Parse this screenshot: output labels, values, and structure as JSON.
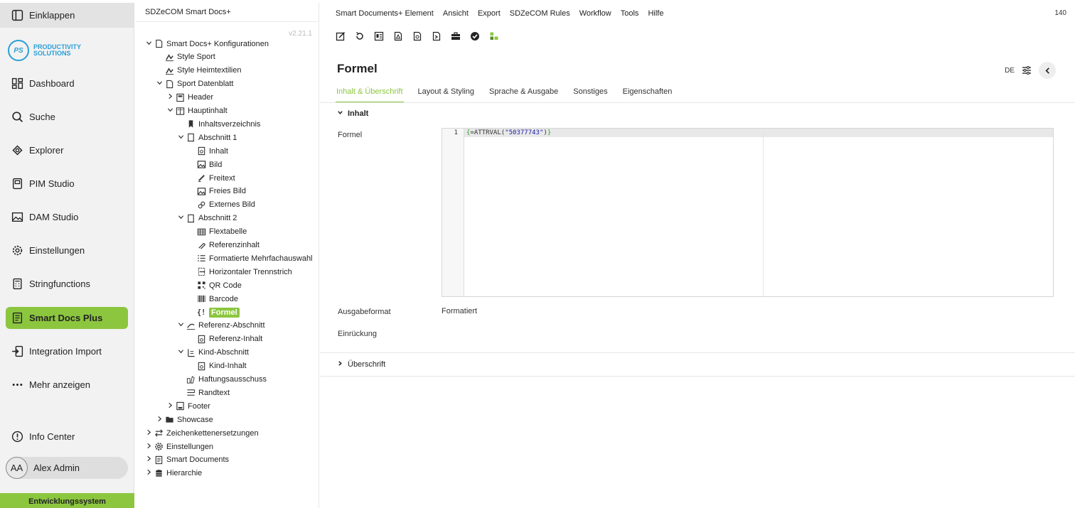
{
  "nav": {
    "collapse_label": "Einklappen",
    "logo_short": "PS",
    "logo_line1": "PRODUCTIVITY",
    "logo_line2": "SOLUTIONS",
    "items": [
      {
        "label": "Dashboard",
        "icon": "dashboard-icon"
      },
      {
        "label": "Suche",
        "icon": "search-icon"
      },
      {
        "label": "Explorer",
        "icon": "explorer-icon"
      },
      {
        "label": "PIM Studio",
        "icon": "pim-icon"
      },
      {
        "label": "DAM Studio",
        "icon": "image-icon"
      },
      {
        "label": "Einstellungen",
        "icon": "gear-icon"
      },
      {
        "label": "Stringfunctions",
        "icon": "calculator-icon"
      },
      {
        "label": "Smart Docs Plus",
        "icon": "document-icon"
      },
      {
        "label": "Integration Import",
        "icon": "import-icon"
      },
      {
        "label": "Mehr anzeigen",
        "icon": "more-icon"
      }
    ],
    "info_center": "Info Center",
    "user_initials": "AA",
    "user_name": "Alex Admin",
    "environment": "Entwicklungssystem",
    "accent_color": "#8cc63f"
  },
  "tree": {
    "title": "SDZeCOM Smart Docs+",
    "version": "v2.21.1",
    "nodes": [
      {
        "label": "Smart Docs+ Konfigurationen",
        "icon": "pdf-icon",
        "chev": "down"
      },
      {
        "label": "Style Sport",
        "icon": "style-icon",
        "chev": ""
      },
      {
        "label": "Style Heimtextilien",
        "icon": "style-icon",
        "chev": ""
      },
      {
        "label": "Sport Datenblatt",
        "icon": "pdf-icon",
        "chev": "down"
      },
      {
        "label": "Header",
        "icon": "header-icon",
        "chev": "right"
      },
      {
        "label": "Hauptinhalt",
        "icon": "content-icon",
        "chev": "down"
      },
      {
        "label": "Inhaltsverzeichnis",
        "icon": "bookmark-icon",
        "chev": ""
      },
      {
        "label": "Abschnitt 1",
        "icon": "section-icon",
        "chev": "down"
      },
      {
        "label": "Inhalt",
        "icon": "content-item-icon",
        "chev": ""
      },
      {
        "label": "Bild",
        "icon": "image-icon",
        "chev": ""
      },
      {
        "label": "Freitext",
        "icon": "pen-icon",
        "chev": ""
      },
      {
        "label": "Freies Bild",
        "icon": "image-icon",
        "chev": ""
      },
      {
        "label": "Externes Bild",
        "icon": "link-icon",
        "chev": ""
      },
      {
        "label": "Abschnitt 2",
        "icon": "section-icon",
        "chev": "down"
      },
      {
        "label": "Flextabelle",
        "icon": "table-icon",
        "chev": ""
      },
      {
        "label": "Referenzinhalt",
        "icon": "reference-icon",
        "chev": ""
      },
      {
        "label": "Formatierte Mehrfachauswahl",
        "icon": "list-icon",
        "chev": ""
      },
      {
        "label": "Horizontaler Trennstrich",
        "icon": "separator-icon",
        "chev": ""
      },
      {
        "label": "QR Code",
        "icon": "qr-icon",
        "chev": ""
      },
      {
        "label": "Barcode",
        "icon": "barcode-icon",
        "chev": ""
      },
      {
        "label": "Formel",
        "icon": "formula-icon",
        "chev": "",
        "selected": true
      },
      {
        "label": "Referenz-Abschnitt",
        "icon": "reference-section-icon",
        "chev": "down"
      },
      {
        "label": "Referenz-Inhalt",
        "icon": "content-item-icon",
        "chev": ""
      },
      {
        "label": "Kind-Abschnitt",
        "icon": "child-section-icon",
        "chev": "down"
      },
      {
        "label": "Kind-Inhalt",
        "icon": "content-item-icon",
        "chev": ""
      },
      {
        "label": "Haftungsausschuss",
        "icon": "disclaimer-icon",
        "chev": ""
      },
      {
        "label": "Randtext",
        "icon": "margin-text-icon",
        "chev": ""
      },
      {
        "label": "Footer",
        "icon": "footer-icon",
        "chev": "right"
      },
      {
        "label": "Showcase",
        "icon": "folder-icon",
        "chev": "right"
      },
      {
        "label": "Zeichenkettenersetzungen",
        "icon": "swap-icon",
        "chev": "right"
      },
      {
        "label": "Einstellungen",
        "icon": "gear-icon",
        "chev": "right"
      },
      {
        "label": "Smart Documents",
        "icon": "document-icon",
        "chev": "right"
      },
      {
        "label": "Hierarchie",
        "icon": "database-icon",
        "chev": "right"
      }
    ]
  },
  "main": {
    "menu": [
      "Smart Documents+ Element",
      "Ansicht",
      "Export",
      "SDZeCOM Rules",
      "Workflow",
      "Tools",
      "Hilfe"
    ],
    "count": "140",
    "toolbar": [
      "edit-icon",
      "reload-icon",
      "preview-icon",
      "pdf-icon",
      "docx-icon",
      "export-icon",
      "briefcase-icon",
      "check-icon",
      "tree-icon"
    ],
    "title": "Formel",
    "lang": "DE",
    "tabs": [
      "Inhalt & Überschrift",
      "Layout & Styling",
      "Sprache & Ausgabe",
      "Sonstiges",
      "Eigenschaften"
    ],
    "section_inhalt": "Inhalt",
    "formel_label": "Formel",
    "code_line_no": "1",
    "code_open": "{",
    "code_func": "=ATTRVAL(",
    "code_string": "\"50377743\"",
    "code_close_paren": ")",
    "code_close": "}",
    "ausgabeformat_label": "Ausgabeformat",
    "ausgabeformat_value": "Formatiert",
    "einrueckung_label": "Einrückung",
    "section_ueberschrift": "Überschrift"
  }
}
